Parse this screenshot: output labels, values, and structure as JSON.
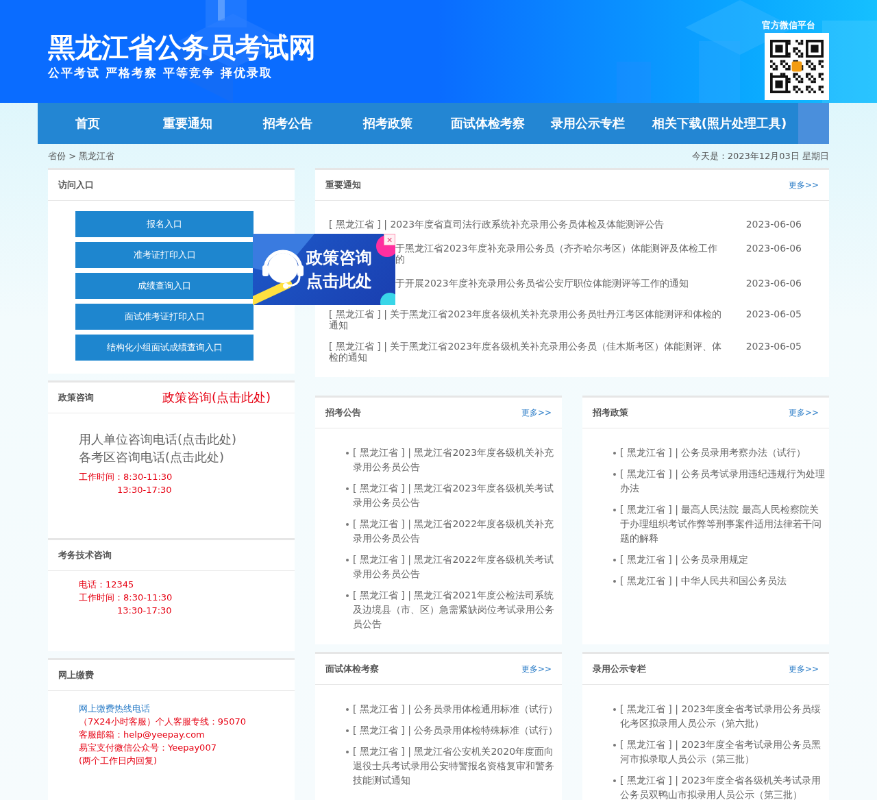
{
  "header": {
    "title": "黑龙江省公务员考试网",
    "slogan": "公平考试 严格考察 平等竞争 择优录取",
    "qr_label": "官方微信平台"
  },
  "nav": [
    "首页",
    "重要通知",
    "招考公告",
    "招考政策",
    "面试体检考察",
    "录用公示专栏",
    "相关下载(照片处理工具)"
  ],
  "breadcrumb": "省份 > 黑龙江省",
  "today": "今天是：2023年12月03日 星期日",
  "access": {
    "title": "访问入口",
    "buttons": [
      "报名入口",
      "准考证打印入口",
      "成绩查询入口",
      "面试准考证打印入口",
      "结构化小组面试成绩查询入口"
    ]
  },
  "policy": {
    "title": "政策咨询",
    "link": "政策咨询(点击此处)",
    "phones": [
      "用人单位咨询电话(点击此处)",
      "各考区咨询电话(点击此处)"
    ],
    "hours": [
      "工作时间：8:30-11:30",
      "13:30-17:30"
    ]
  },
  "tech": {
    "title": "考务技术咨询",
    "lines": [
      "电话：12345",
      "工作时间：8:30-11:30",
      "13:30-17:30"
    ]
  },
  "payment": {
    "title": "网上缴费",
    "hotline": "网上缴费热线电话",
    "lines": [
      "（7X24小时客服）个人客服专线：95070",
      "客服邮箱：help@yeepay.com",
      "易宝支付微信公众号：Yeepay007",
      "(两个工作日内回复)"
    ]
  },
  "notices": {
    "title": "重要通知",
    "more": "更多>>",
    "items": [
      {
        "text": "[ 黑龙江省 ] | 2023年度省直司法行政系统补充录用公务员体检及体能测评公告",
        "date": "2023-06-06",
        "covered": false
      },
      {
        "text": "于黑龙江省2023年度补充录用公务员（齐齐哈尔考区）体能测评及体检工作的",
        "date": "2023-06-06",
        "covered": true
      },
      {
        "text": "于开展2023年度补充录用公务员省公安厅职位体能测评等工作的通知",
        "date": "2023-06-06",
        "covered": true
      },
      {
        "text": "[ 黑龙江省 ] | 关于黑龙江省2023年度各级机关补充录用公务员牡丹江考区体能测评和体检的通知",
        "date": "2023-06-05",
        "covered": false
      },
      {
        "text": "[ 黑龙江省 ] | 关于黑龙江省2023年度各级机关补充录用公务员（佳木斯考区）体能测评、体检的通知",
        "date": "2023-06-05",
        "covered": false
      }
    ]
  },
  "lists": [
    {
      "title": "招考公告",
      "more": "更多>>",
      "items": [
        "[ 黑龙江省 ] | 黑龙江省2023年度各级机关补充录用公务员公告",
        "[ 黑龙江省 ] | 黑龙江省2023年度各级机关考试录用公务员公告",
        "[ 黑龙江省 ] | 黑龙江省2022年度各级机关补充录用公务员公告",
        "[ 黑龙江省 ] | 黑龙江省2022年度各级机关考试录用公务员公告",
        "[ 黑龙江省 ] | 黑龙江省2021年度公检法司系统及边境县（市、区）急需紧缺岗位考试录用公务员公告"
      ]
    },
    {
      "title": "招考政策",
      "more": "更多>>",
      "items": [
        "[ 黑龙江省 ] | 公务员录用考察办法（试行）",
        "[ 黑龙江省 ] | 公务员考试录用违纪违规行为处理办法",
        "[ 黑龙江省 ] | 最高人民法院 最高人民检察院关于办理组织考试作弊等刑事案件适用法律若干问题的解释",
        "[ 黑龙江省 ] | 公务员录用规定",
        "[ 黑龙江省 ] | 中华人民共和国公务员法"
      ]
    },
    {
      "title": "面试体检考察",
      "more": "更多>>",
      "items": [
        "[ 黑龙江省 ] | 公务员录用体检通用标准（试行）",
        "[ 黑龙江省 ] | 公务员录用体检特殊标准（试行）",
        "[ 黑龙江省 ] | 黑龙江省公安机关2020年度面向退役士兵考试录用公安特警报名资格复审和警务技能测试通知"
      ]
    },
    {
      "title": "录用公示专栏",
      "more": "更多>>",
      "items": [
        "[ 黑龙江省 ] | 2023年度全省考试录用公务员绥化考区拟录用人员公示（第六批）",
        "[ 黑龙江省 ] | 2023年度全省考试录用公务员黑河市拟录取人员公示（第三批）",
        "[ 黑龙江省 ] | 2023年度全省各级机关考试录用公务员双鸭山市拟录用人员公示（第三批）"
      ]
    }
  ],
  "popup": {
    "lines": [
      "政策咨询",
      "点击此处"
    ],
    "close": "×"
  }
}
